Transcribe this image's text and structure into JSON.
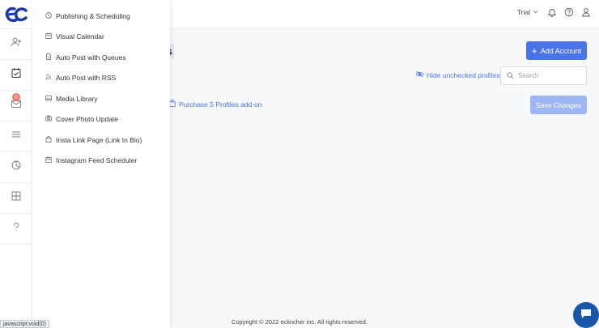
{
  "brand": {
    "logo_icon": "eclincher-logo-icon",
    "accent": "#4a73e8"
  },
  "topbar": {
    "plan_label": "Trial",
    "icons": [
      "chevron-down-icon",
      "bell-icon",
      "help-icon",
      "user-icon"
    ]
  },
  "rail": {
    "items": [
      {
        "icon": "add-user-icon"
      },
      {
        "icon": "calendar-check-icon"
      },
      {
        "icon": "inbox-icon",
        "badge": "0"
      },
      {
        "icon": "menu-lines-icon"
      },
      {
        "icon": "analytics-pie-icon"
      },
      {
        "icon": "grid-icon"
      },
      {
        "icon": "question-icon"
      }
    ]
  },
  "main": {
    "title_fragment": "s",
    "add_account_label": "Add Account",
    "hide_unchecked_label": "Hide unchecked profiles",
    "search_placeholder": "Search",
    "purchase_label": "Purchase 5 Profiles add-on",
    "save_changes_label": "Save Changes"
  },
  "dropdown": {
    "items": [
      {
        "label": "Publishing & Scheduling",
        "icon": "clock-icon"
      },
      {
        "label": "Visual Calendar",
        "icon": "calendar-icon"
      },
      {
        "label": "Auto Post with Queues",
        "icon": "document-icon"
      },
      {
        "label": "Auto Post with RSS",
        "icon": "rss-icon"
      },
      {
        "label": "Media Library",
        "icon": "image-icon"
      },
      {
        "label": "Cover Photo Update",
        "icon": "camera-icon"
      },
      {
        "label": "Insta Link Page (Link In Bio)",
        "icon": "shopping-bag-icon"
      },
      {
        "label": "Instagram Feed Scheduler",
        "icon": "calendar-icon"
      }
    ]
  },
  "footer": {
    "copyright": "Copyright © 2022 eclincher inc. All rights reserved."
  },
  "status_bar": {
    "url": "javascript:void(0)"
  }
}
